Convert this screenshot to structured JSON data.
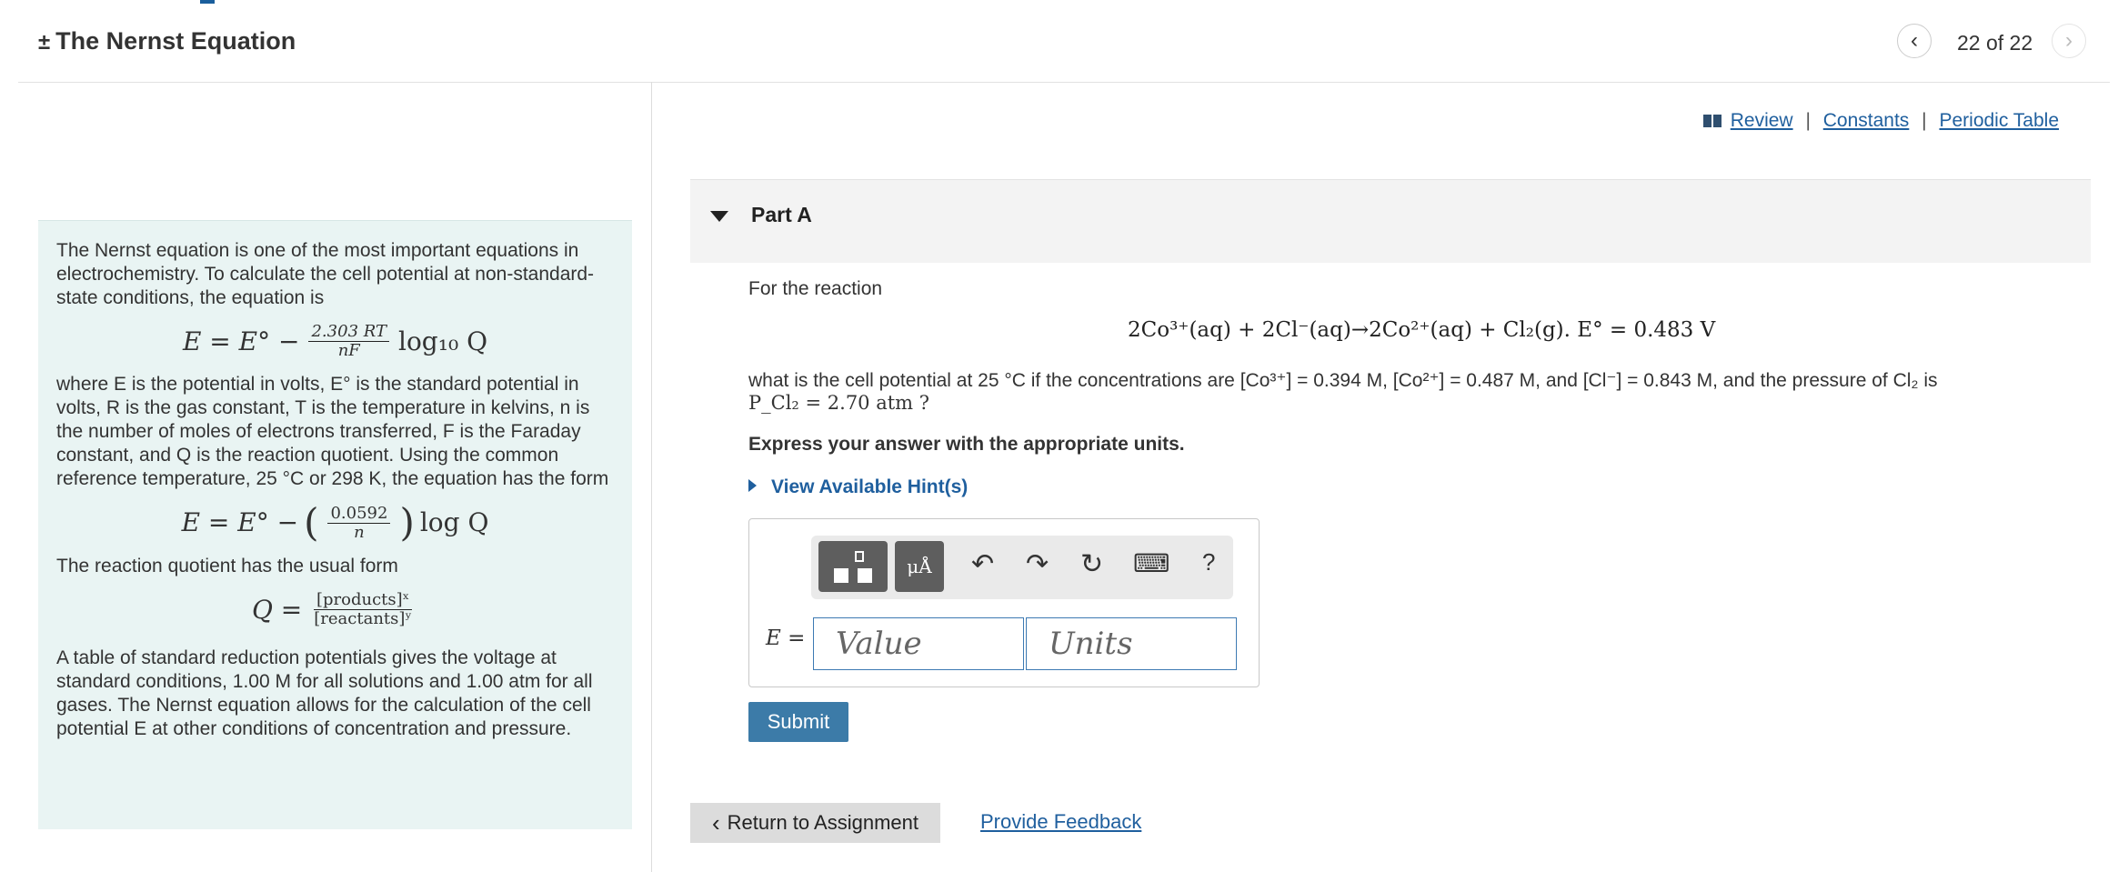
{
  "header": {
    "title": "The Nernst Equation",
    "title_prefix": "±",
    "counter": "22 of 22",
    "prev_icon": "chevron-left-icon",
    "next_icon": "chevron-right-icon"
  },
  "info": {
    "p1": "The Nernst equation is one of the most important equations in electrochemistry. To calculate the cell potential at non-standard-state conditions, the equation is",
    "eq1_lhs": "E = E° −",
    "eq1_num": "2.303 RT",
    "eq1_den": "nF",
    "eq1_rhs": "log₁₀ Q",
    "p2": "where E is the potential in volts, E° is the standard potential in volts, R is the gas constant, T is the temperature in kelvins, n is the number of moles of electrons transferred, F is the Faraday constant, and Q is the reaction quotient. Using the common reference temperature, 25 °C or 298 K, the equation has the form",
    "eq2_lhs": "E = E° −",
    "eq2_num": "0.0592",
    "eq2_den": "n",
    "eq2_rhs": "log Q",
    "p3": "The reaction quotient has the usual form",
    "eq3_lhs": "Q =",
    "eq3_num": "[products]ˣ",
    "eq3_den": "[reactants]ʸ",
    "p4": "A table of standard reduction potentials gives the voltage at standard conditions, 1.00 M for all solutions and 1.00 atm for all gases. The Nernst equation allows for the calculation of the cell potential E at other conditions of concentration and pressure."
  },
  "links": {
    "review": "Review",
    "constants": "Constants",
    "periodic_table": "Periodic Table",
    "sep": "|"
  },
  "part": {
    "title": "Part A"
  },
  "question": {
    "intro": "For the reaction",
    "reaction": "2Co³⁺(aq) + 2Cl⁻(aq)→2Co²⁺(aq) + Cl₂(g).  E° = 0.483 V",
    "line1": "what is the cell potential at 25 °C if the concentrations are [Co³⁺] = 0.394 M, [Co²⁺] = 0.487 M, and [Cl⁻] = 0.843 M, and the pressure of Cl₂ is",
    "line2": "P_Cl₂ = 2.70 atm ?",
    "instruction": "Express your answer with the appropriate units."
  },
  "hint": {
    "label": "View Available Hint(s)"
  },
  "answer": {
    "label": "E =",
    "value_placeholder": "Value",
    "units_placeholder": "Units",
    "toolbar_help": "?"
  },
  "buttons": {
    "submit": "Submit",
    "return": "Return to Assignment",
    "feedback": "Provide Feedback"
  }
}
